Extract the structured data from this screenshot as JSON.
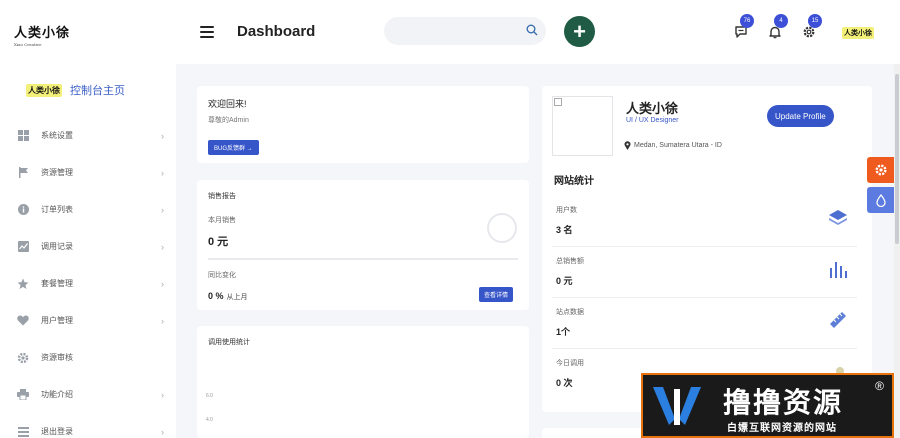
{
  "sidebar": {
    "brand": "人类小徐",
    "brand_small": "Xiao Creative",
    "home_logo": "人类小徐",
    "home_label": "控制台主页",
    "items": [
      {
        "icon": "grid-icon",
        "label": "系统设置"
      },
      {
        "icon": "flag-icon",
        "label": "资源管理"
      },
      {
        "icon": "info-icon",
        "label": "订单列表"
      },
      {
        "icon": "chart-icon",
        "label": "调用记录"
      },
      {
        "icon": "star-icon",
        "label": "套餐管理"
      },
      {
        "icon": "heart-icon",
        "label": "用户管理"
      },
      {
        "icon": "cog-icon",
        "label": "资源审核"
      },
      {
        "icon": "printer-icon",
        "label": "功能介绍"
      },
      {
        "icon": "list-icon",
        "label": "退出登录"
      }
    ]
  },
  "header": {
    "title": "Dashboard",
    "search_placeholder": "",
    "badges": {
      "messages": "76",
      "notifications": "4",
      "settings": "15"
    },
    "avatar_logo": "人类小徐"
  },
  "welcome": {
    "title": "欢迎回来!",
    "subtitle": "尊敬的Admin",
    "bug_button": "BUG反馈群 →"
  },
  "sales": {
    "title": "销售报告",
    "month_label": "本月销售",
    "month_amount": "0 元",
    "change_label": "同比变化",
    "change_value": "0 %",
    "change_unit": "从上月",
    "detail_button": "查看详情"
  },
  "usage": {
    "title": "调用使用统计",
    "ticks": [
      "6.0",
      "4.0"
    ]
  },
  "profile": {
    "name": "人类小徐",
    "role": "UI / UX Designer",
    "location": "Medan, Sumatera Utara - ID",
    "update_button": "Update Profile",
    "stats_title": "网站统计",
    "stats": [
      {
        "label": "用户数",
        "value": "3 名",
        "icon": "layers-icon"
      },
      {
        "label": "总销售额",
        "value": "0 元",
        "icon": "bar-chart-icon"
      },
      {
        "label": "站点数据",
        "value": "1个",
        "icon": "ruler-icon"
      },
      {
        "label": "今日调用",
        "value": "0 次",
        "icon": "dot-icon"
      }
    ]
  },
  "watermark": {
    "title": "撸撸资源",
    "reg": "®",
    "subtitle": "白嫖互联网资源的网站"
  },
  "colors": {
    "accent": "#3655c9",
    "add_button": "#1f5b45",
    "fab_gear": "#ef5a1f",
    "fab_drop": "#5b7be0",
    "watermark_border": "#e8730c"
  }
}
